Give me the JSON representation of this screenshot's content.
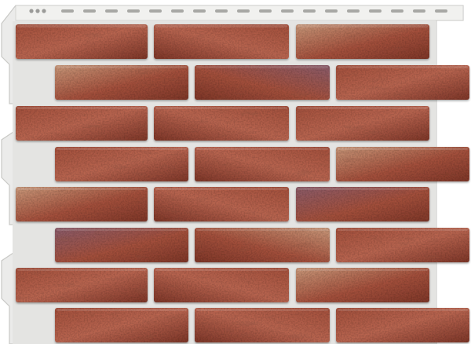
{
  "image": {
    "subject": "brick-facade-panel",
    "colors": {
      "background": "#ffffff",
      "mortar": "#e4e4e2",
      "mortar_edge": "#cfcfcc",
      "frame": "#ebebea",
      "frame_shadow": "#c9c9c6",
      "brick_base": "#a4503c",
      "brick_dark": "#7e3628",
      "brick_light": "#b96550",
      "brick_tan": "#c9987a",
      "brick_purple": "#8a5b6a"
    },
    "bricks": [
      {
        "variant": "red"
      },
      {
        "variant": "red"
      },
      {
        "variant": "tan"
      },
      {
        "variant": "tan"
      },
      {
        "variant": "purple"
      },
      {
        "variant": "red"
      },
      {
        "variant": "red"
      },
      {
        "variant": "red"
      },
      {
        "variant": "red"
      },
      {
        "variant": "red"
      },
      {
        "variant": "red"
      },
      {
        "variant": "tan"
      },
      {
        "variant": "tan"
      },
      {
        "variant": "red"
      },
      {
        "variant": "purple"
      },
      {
        "variant": "purple"
      },
      {
        "variant": "tan"
      },
      {
        "variant": "red"
      },
      {
        "variant": "red"
      },
      {
        "variant": "red"
      },
      {
        "variant": "tan"
      },
      {
        "variant": "red"
      },
      {
        "variant": "red"
      },
      {
        "variant": "red"
      }
    ]
  }
}
